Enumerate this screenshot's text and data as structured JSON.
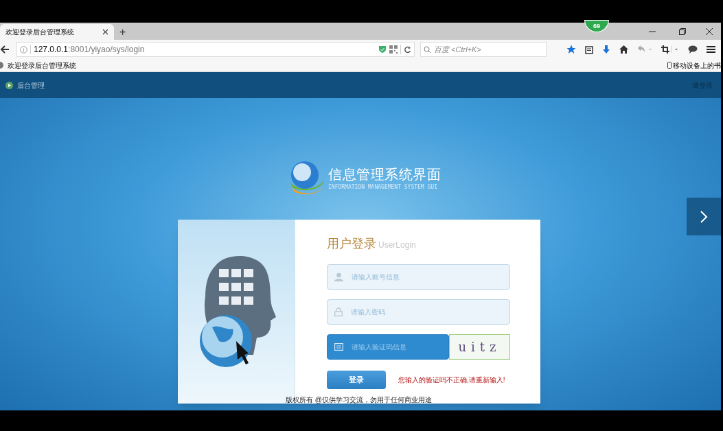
{
  "browser": {
    "tab_title": "欢迎登录后台管理系统",
    "new_tab": "+",
    "url_host": "127.0.0.1",
    "url_rest": ":8001/yiyao/sys/login",
    "search_placeholder": "百度 <Ctrl+K>",
    "bookmark": "欢迎登录后台管理系统",
    "mobile_bookmarks": "移动设备上的书",
    "badge": "69"
  },
  "header": {
    "title": "后台管理",
    "login_link": "请登录"
  },
  "logo": {
    "title": "信息管理系统界面",
    "subtitle": "INFORMATION MANAGEMENT SYSTEM GUI"
  },
  "login": {
    "heading": "用户登录",
    "heading_en": "UserLogin",
    "fields": [
      {
        "kind": "user",
        "placeholder": "请输入账号信息",
        "focused": false
      },
      {
        "kind": "lock",
        "placeholder": "请输入密码",
        "focused": false
      },
      {
        "kind": "captcha",
        "placeholder": "请输入验证码信息",
        "focused": true
      }
    ],
    "captcha_text": "uitz",
    "button": "登录",
    "error": "您输入的验证吗不正确,请重新输入!",
    "footer": "版权所有 @仅供学习交流，勿用于任何商业用途"
  }
}
